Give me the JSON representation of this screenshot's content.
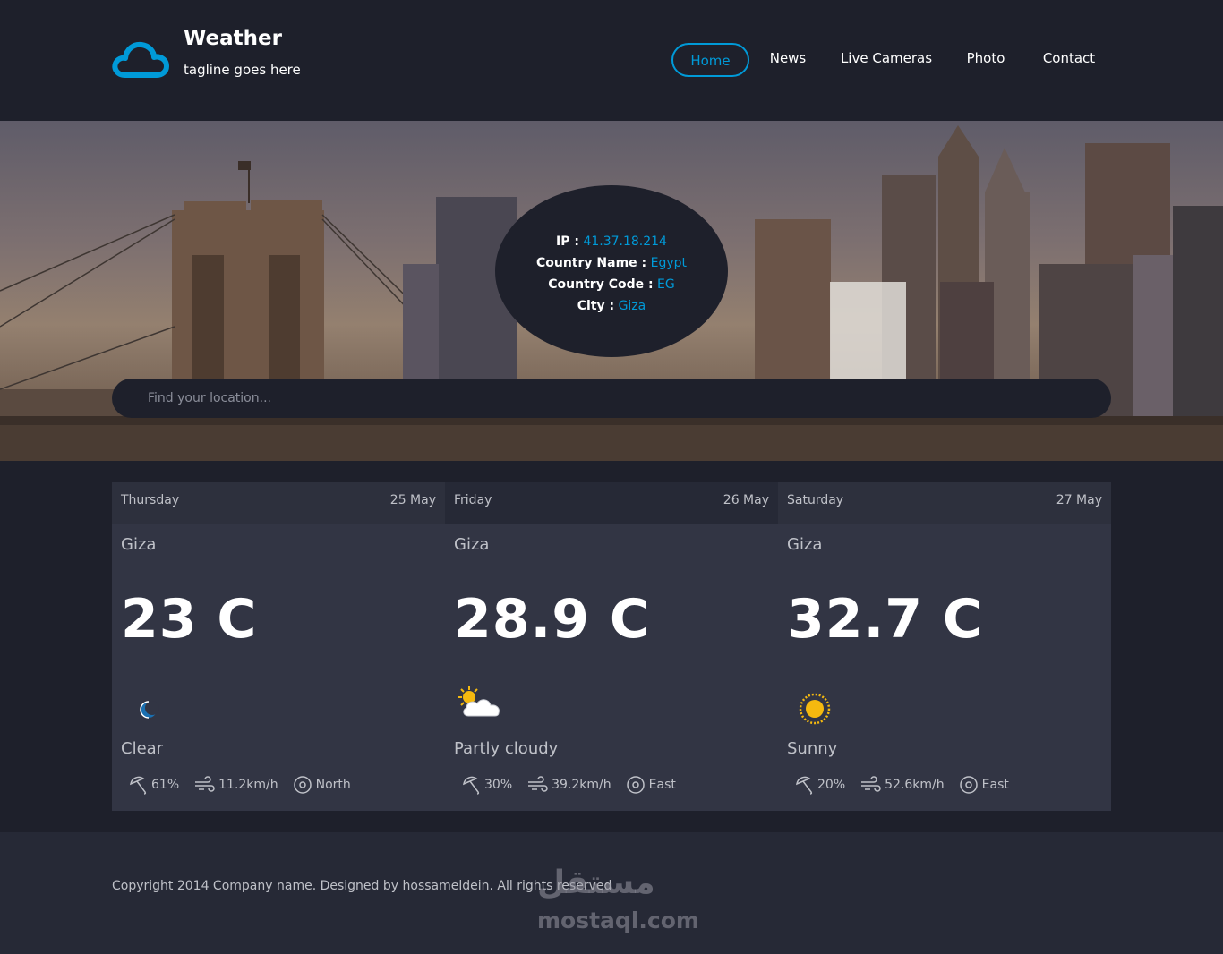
{
  "header": {
    "title": "Weather",
    "tagline": "tagline goes here",
    "nav": [
      "Home",
      "News",
      "Live Cameras",
      "Photo",
      "Contact"
    ],
    "active_nav": "Home",
    "accent_color": "#009ad8"
  },
  "location": {
    "ip_label": "IP :",
    "ip": "41.37.18.214",
    "country_name_label": "Country Name :",
    "country_name": "Egypt",
    "country_code_label": "Country Code :",
    "country_code": "EG",
    "city_label": "City :",
    "city": "Giza"
  },
  "search": {
    "placeholder": "Find your location..."
  },
  "forecast": [
    {
      "day": "Thursday",
      "date": "25 May",
      "city": "Giza",
      "temp": "23 C",
      "icon": "moon-icon",
      "condition": "Clear",
      "humidity": "61%",
      "wind": "11.2km/h",
      "direction": "North"
    },
    {
      "day": "Friday",
      "date": "26 May",
      "city": "Giza",
      "temp": "28.9 C",
      "icon": "partly-cloudy-icon",
      "condition": "Partly cloudy",
      "humidity": "30%",
      "wind": "39.2km/h",
      "direction": "East"
    },
    {
      "day": "Saturday",
      "date": "27 May",
      "city": "Giza",
      "temp": "32.7 C",
      "icon": "sun-icon",
      "condition": "Sunny",
      "humidity": "20%",
      "wind": "52.6km/h",
      "direction": "East"
    }
  ],
  "footer": {
    "copyright": "Copyright 2014 Company name. Designed by hossameldein. All rights reserved"
  },
  "watermark": {
    "arabic": "مستقل",
    "latin": "mostaql.com"
  }
}
